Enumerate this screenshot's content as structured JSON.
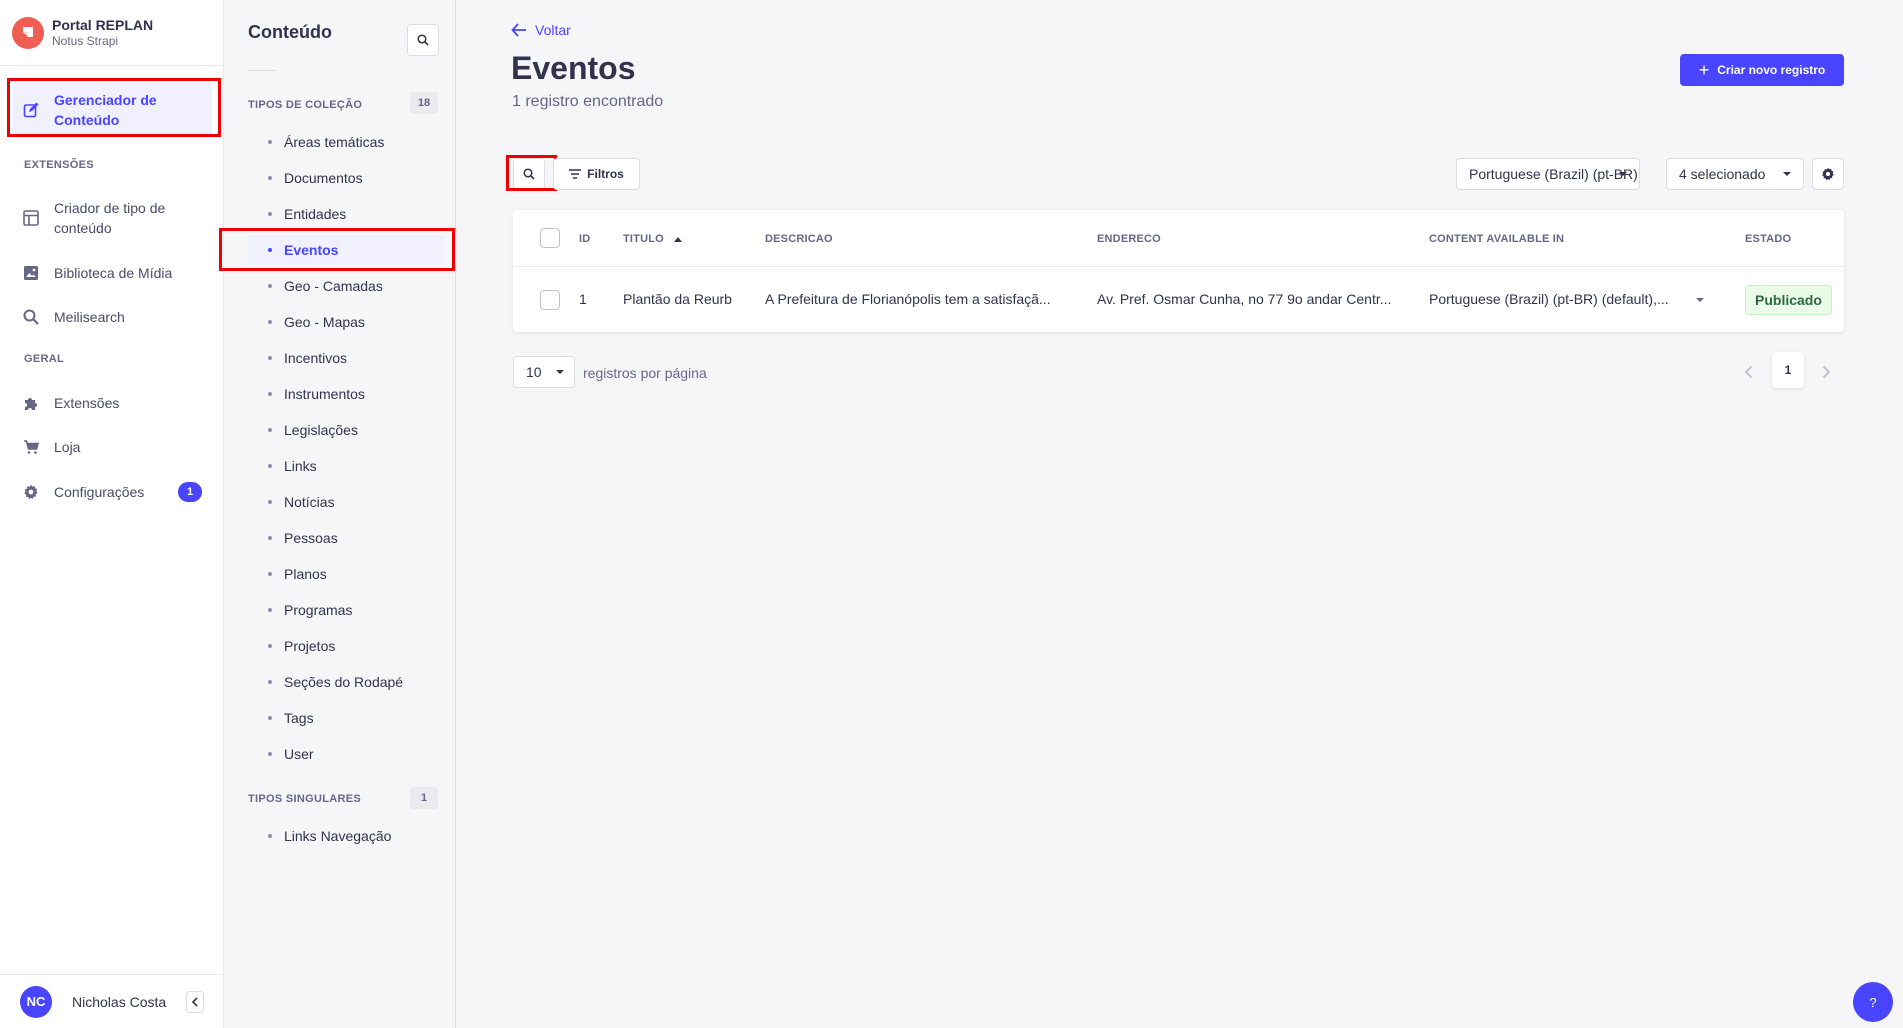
{
  "brand": {
    "title": "Portal REPLAN",
    "subtitle": "Notus Strapi"
  },
  "mainnav": {
    "content_manager": "Gerenciador de Conteúdo",
    "section_plugins": "EXTENSÕES",
    "content_type_builder": "Criador de tipo de conteúdo",
    "media_library": "Biblioteca de Mídia",
    "meilisearch": "Meilisearch",
    "section_general": "GERAL",
    "plugins": "Extensões",
    "marketplace": "Loja",
    "settings": "Configurações",
    "settings_badge": "1"
  },
  "user": {
    "initials": "NC",
    "name": "Nicholas Costa"
  },
  "subnav": {
    "title": "Conteúdo",
    "collection_section": "TIPOS DE COLEÇÃO",
    "collection_count": "18",
    "collection_items": [
      "Áreas temáticas",
      "Documentos",
      "Entidades",
      "Eventos",
      "Geo - Camadas",
      "Geo - Mapas",
      "Incentivos",
      "Instrumentos",
      "Legislações",
      "Links",
      "Notícias",
      "Pessoas",
      "Planos",
      "Programas",
      "Projetos",
      "Seções do Rodapé",
      "Tags",
      "User"
    ],
    "single_section": "TIPOS SINGULARES",
    "single_count": "1",
    "single_items": [
      "Links Navegação"
    ]
  },
  "main": {
    "back": "Voltar",
    "title": "Eventos",
    "subtitle": "1 registro encontrado",
    "create_button": "Criar novo registro",
    "filters": "Filtros",
    "locale_select": "Portuguese (Brazil) (pt-BR)",
    "columns_select": "4 selecionado",
    "table": {
      "headers": {
        "id": "ID",
        "titulo": "TITULO",
        "descricao": "DESCRICAO",
        "endereco": "ENDERECO",
        "available": "CONTENT AVAILABLE IN",
        "estado": "ESTADO"
      },
      "rows": [
        {
          "id": "1",
          "titulo": "Plantão da Reurb",
          "descricao": "A Prefeitura de Florianópolis tem a satisfaçã...",
          "endereco": "Av. Pref. Osmar Cunha, no 77 9o andar Centr...",
          "available": "Portuguese (Brazil) (pt-BR) (default),...",
          "estado": "Publicado"
        }
      ]
    },
    "per_page_value": "10",
    "per_page_label": "registros por página",
    "current_page": "1"
  },
  "help": "?",
  "colors": {
    "accent": "#4945ff",
    "highlight": "#e00000",
    "status_bg": "#eafbe7"
  }
}
